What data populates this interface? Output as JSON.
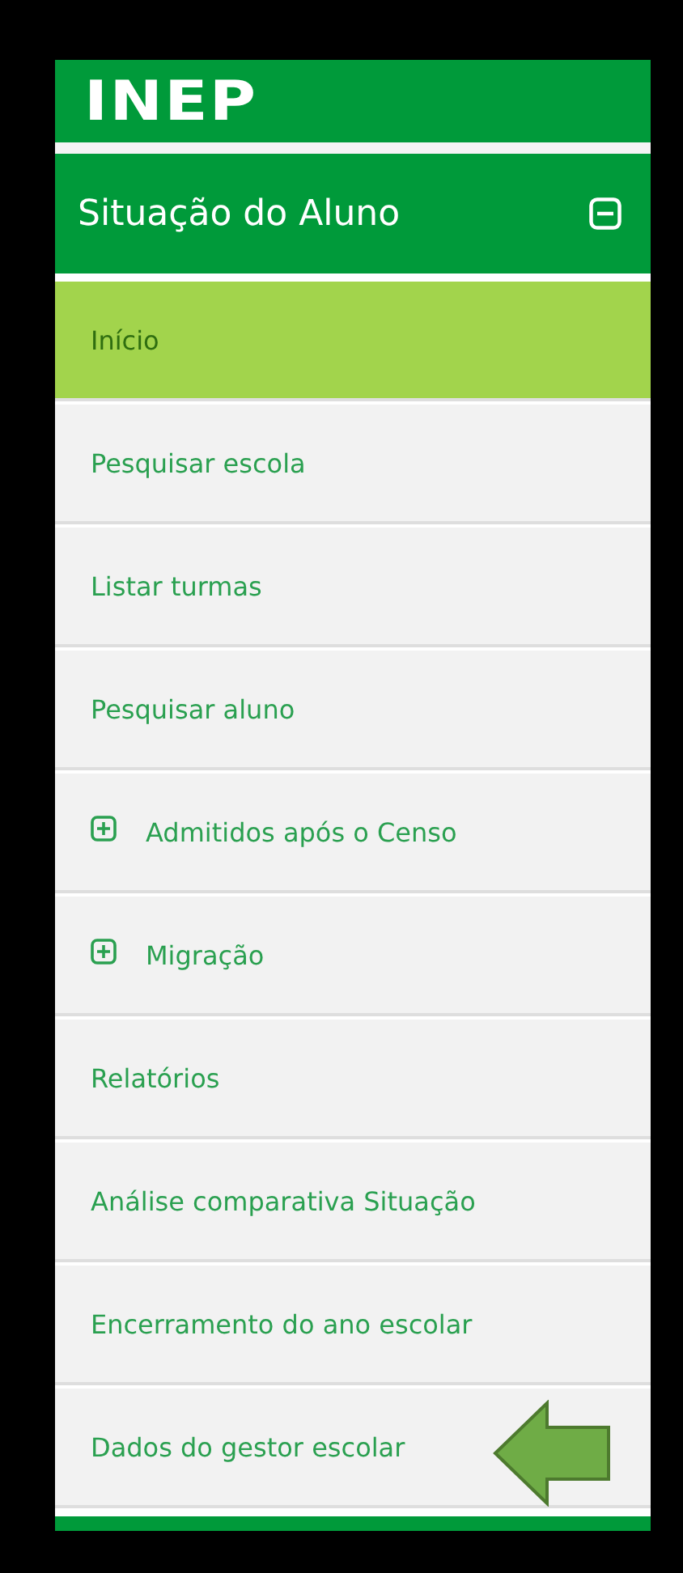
{
  "logo": {
    "text": "INEP"
  },
  "menu": {
    "title": "Situação do Aluno",
    "expanded": true,
    "items": [
      {
        "label": "Início",
        "kind": "link",
        "selected": true
      },
      {
        "label": "Pesquisar escola",
        "kind": "link",
        "selected": false
      },
      {
        "label": "Listar turmas",
        "kind": "link",
        "selected": false
      },
      {
        "label": "Pesquisar aluno",
        "kind": "link",
        "selected": false
      },
      {
        "label": "Admitidos após o Censo",
        "kind": "group",
        "expanded": false,
        "selected": false
      },
      {
        "label": "Migração",
        "kind": "group",
        "expanded": false,
        "selected": false
      },
      {
        "label": "Relatórios",
        "kind": "link",
        "selected": false
      },
      {
        "label": "Análise comparativa Situação",
        "kind": "link",
        "selected": false
      },
      {
        "label": "Encerramento do ano escolar",
        "kind": "link",
        "selected": false
      },
      {
        "label": "Dados do gestor escolar",
        "kind": "link",
        "selected": false,
        "highlighted": true
      }
    ]
  }
}
